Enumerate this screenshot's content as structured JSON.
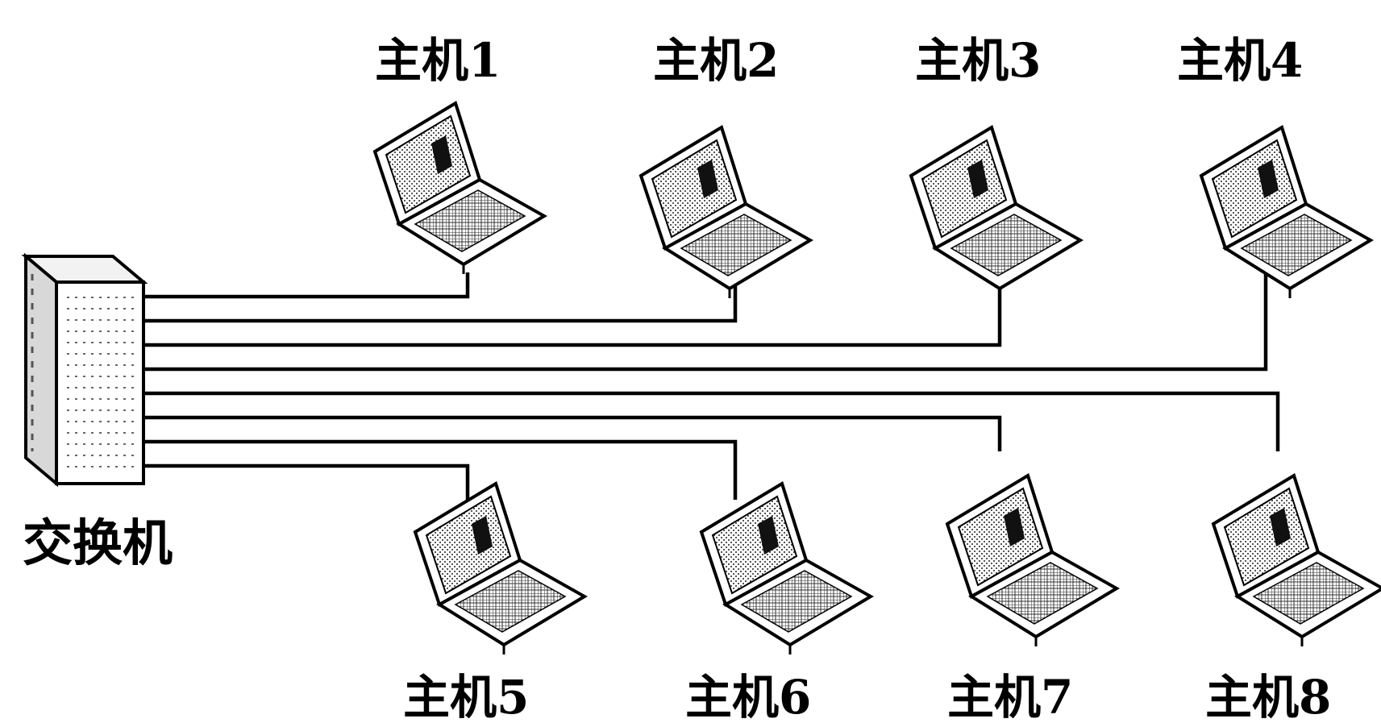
{
  "switch": {
    "label": "交换机",
    "icon": "network-switch-tower-icon"
  },
  "hosts": [
    {
      "label": "主机1",
      "row": "top",
      "icon": "laptop-icon"
    },
    {
      "label": "主机2",
      "row": "top",
      "icon": "laptop-icon"
    },
    {
      "label": "主机3",
      "row": "top",
      "icon": "laptop-icon"
    },
    {
      "label": "主机4",
      "row": "top",
      "icon": "laptop-icon"
    },
    {
      "label": "主机5",
      "row": "bottom",
      "icon": "laptop-icon"
    },
    {
      "label": "主机6",
      "row": "bottom",
      "icon": "laptop-icon"
    },
    {
      "label": "主机7",
      "row": "bottom",
      "icon": "laptop-icon"
    },
    {
      "label": "主机8",
      "row": "bottom",
      "icon": "laptop-icon"
    }
  ],
  "colors": {
    "line": "#000000",
    "background": "#ffffff"
  }
}
